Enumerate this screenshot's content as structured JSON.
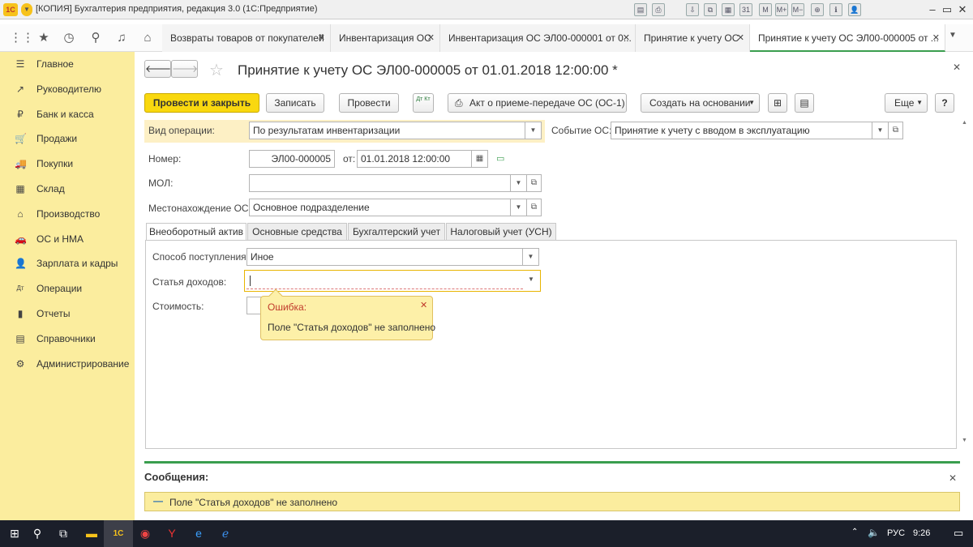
{
  "window": {
    "logo": "1С",
    "title": "[КОПИЯ] Бухгалтерия предприятия, редакция 3.0  (1С:Предприятие)",
    "toolbar_icons": [
      "save-icon",
      "print-icon",
      "export-icon",
      "copy-icon",
      "calc-icon",
      "calendar-icon",
      "m-icon",
      "m-plus-icon",
      "m-minus-icon",
      "zoom-icon",
      "info-icon",
      "user-icon"
    ],
    "toolbar_glyphs": [
      "▤",
      "⎙",
      "⇩",
      "⧉",
      "▦",
      "31",
      "M",
      "M+",
      "M−",
      "⊕",
      "ℹ",
      "👤"
    ]
  },
  "nav": {
    "tabs": [
      {
        "label": "Возвраты товаров от покупателей"
      },
      {
        "label": "Инвентаризация ОС"
      },
      {
        "label": "Инвентаризация ОС ЭЛ00-000001 от 0..."
      },
      {
        "label": "Принятие к учету ОС"
      },
      {
        "label": "Принятие к учету ОС ЭЛ00-000005 от ..."
      }
    ]
  },
  "sidebar": {
    "items": [
      {
        "label": "Главное",
        "icon": "menu-icon",
        "glyph": "☰"
      },
      {
        "label": "Руководителю",
        "icon": "trend-icon",
        "glyph": "↗"
      },
      {
        "label": "Банк и касса",
        "icon": "ruble-icon",
        "glyph": "₽"
      },
      {
        "label": "Продажи",
        "icon": "cart-icon",
        "glyph": "🛒"
      },
      {
        "label": "Покупки",
        "icon": "truck-icon",
        "glyph": "🚚"
      },
      {
        "label": "Склад",
        "icon": "warehouse-icon",
        "glyph": "▦"
      },
      {
        "label": "Производство",
        "icon": "factory-icon",
        "glyph": "⌂"
      },
      {
        "label": "ОС и НМА",
        "icon": "car-icon",
        "glyph": "🚗"
      },
      {
        "label": "Зарплата и кадры",
        "icon": "person-icon",
        "glyph": "👤"
      },
      {
        "label": "Операции",
        "icon": "dt-kt-icon",
        "glyph": "Дт"
      },
      {
        "label": "Отчеты",
        "icon": "bar-chart-icon",
        "glyph": "▮"
      },
      {
        "label": "Справочники",
        "icon": "book-icon",
        "glyph": "▤"
      },
      {
        "label": "Администрирование",
        "icon": "gear-icon",
        "glyph": "⚙"
      }
    ]
  },
  "doc": {
    "title": "Принятие к учету ОС ЭЛ00-000005 от 01.01.2018 12:00:00 *",
    "buttons": {
      "post_close": "Провести и закрыть",
      "save": "Записать",
      "post": "Провести",
      "dtkt": "Дт Кт",
      "act": "Акт о приеме-передаче ОС (ОС-1)",
      "create_based": "Создать на основании",
      "more": "Еще",
      "help": "?"
    },
    "fields": {
      "op_type_label": "Вид операции:",
      "op_type_value": "По результатам инвентаризации",
      "event_label": "Событие ОС:",
      "event_value": "Принятие к учету с вводом в эксплуатацию",
      "number_label": "Номер:",
      "number_value": "ЭЛ00-000005",
      "date_from": "от:",
      "date_value": "01.01.2018 12:00:00",
      "mol_label": "МОЛ:",
      "mol_value": "",
      "location_label": "Местонахождение ОС:",
      "location_value": "Основное подразделение"
    },
    "tabs": [
      "Внеоборотный актив",
      "Основные средства",
      "Бухгалтерский учет",
      "Налоговый учет (УСН)"
    ],
    "tab_fields": {
      "receipt_label": "Способ поступления:",
      "receipt_value": "Иное",
      "income_label": "Статья доходов:",
      "income_value": "",
      "cost_label": "Стоимость:"
    },
    "tooltip": {
      "title": "Ошибка:",
      "text": "Поле \"Статья доходов\" не заполнено"
    }
  },
  "messages": {
    "title": "Сообщения:",
    "items": [
      "Поле \"Статья доходов\" не заполнено"
    ]
  },
  "taskbar": {
    "lang": "РУС",
    "time": "9:26"
  },
  "colors": {
    "sidebar": "#fbed9e",
    "primary_button": "#f9d80f",
    "accent_green": "#3a9e4e",
    "error_red": "#c0392b"
  }
}
